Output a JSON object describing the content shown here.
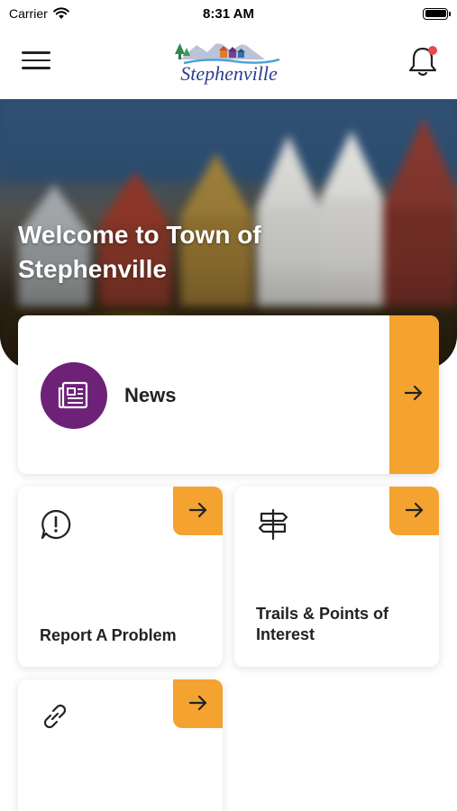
{
  "status_bar": {
    "carrier": "Carrier",
    "time": "8:31 AM",
    "icons": [
      "wifi-icon",
      "battery-icon"
    ]
  },
  "header": {
    "logo_text": "Stephenville",
    "icons": [
      "menu-icon",
      "bell-icon"
    ],
    "notification_dot_color": "#e84a4a"
  },
  "hero": {
    "title": "Welcome to Town of Stephenville"
  },
  "cards": {
    "news": {
      "label": "News",
      "icon": "newspaper-icon"
    },
    "report": {
      "label": "Report A Problem",
      "icon": "alert-bubble-icon"
    },
    "trails": {
      "label": "Trails & Points of Interest",
      "icon": "signpost-icon"
    },
    "links": {
      "label": "",
      "icon": "link-icon"
    }
  },
  "colors": {
    "accent": "#f4a230",
    "news_icon_bg": "#6d2277",
    "logo_text": "#2b3f8f"
  }
}
